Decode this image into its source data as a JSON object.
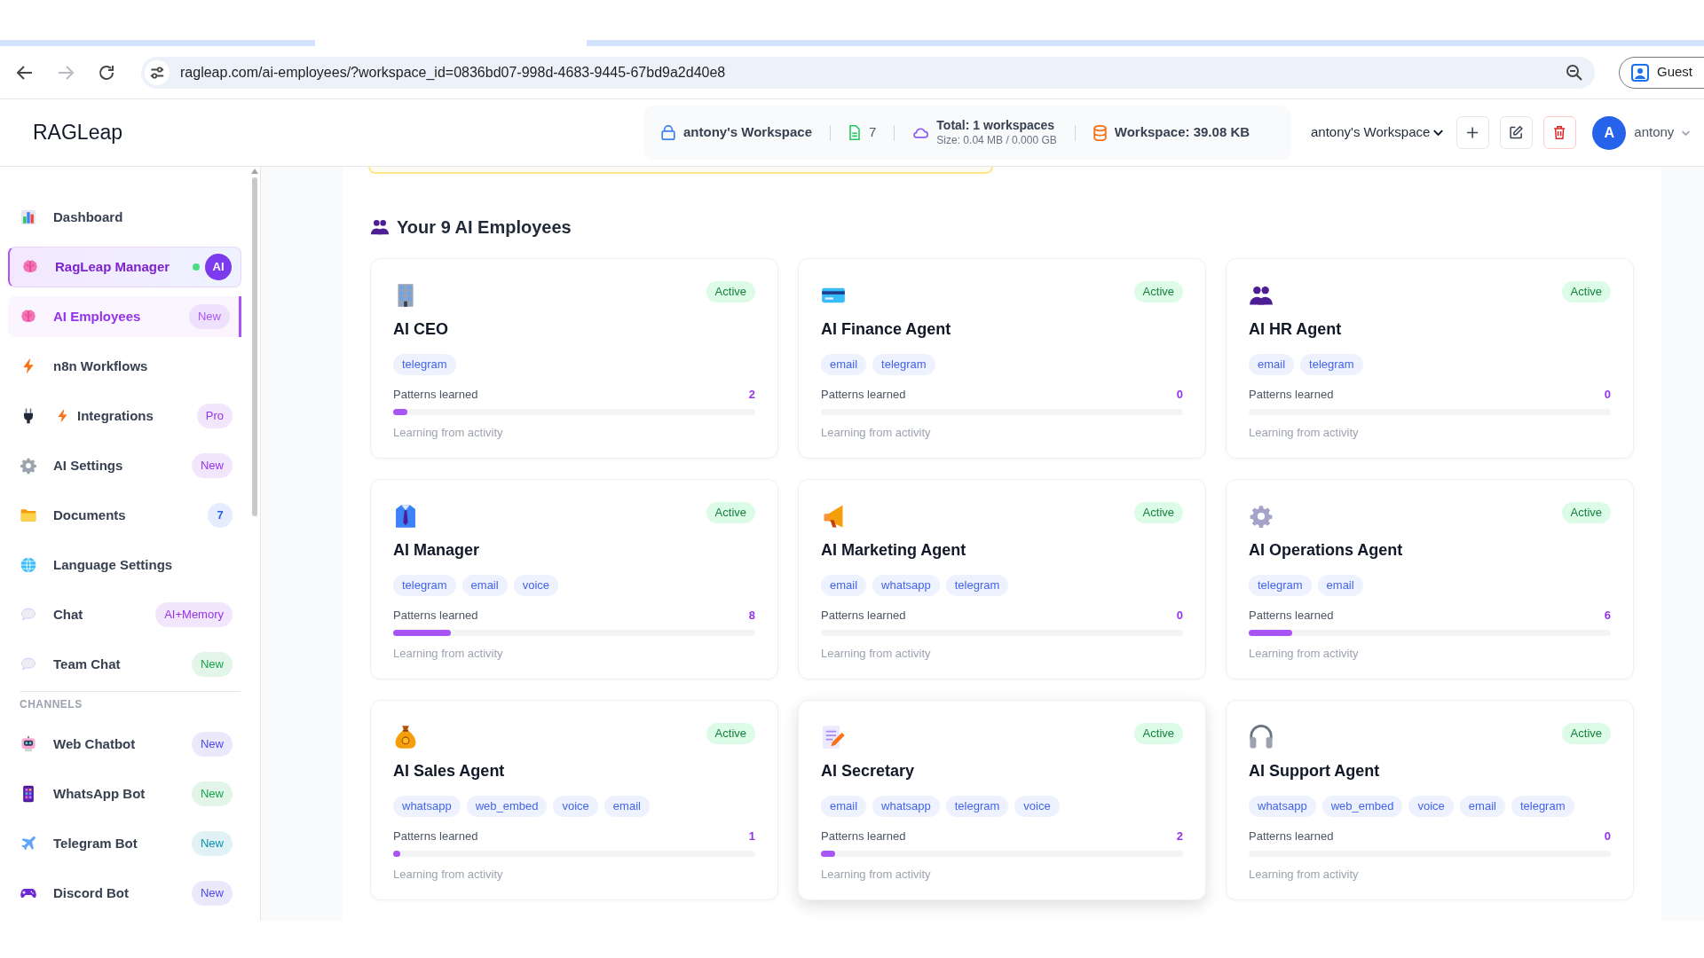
{
  "browser": {
    "nav": [
      {
        "kind": "back",
        "disabled": false
      },
      {
        "kind": "forward",
        "disabled": true
      },
      {
        "kind": "reload",
        "disabled": false
      }
    ],
    "url": "ragleap.com/ai-employees/?workspace_id=0836bd07-998d-4683-9445-67bd9a2d40e8",
    "profile_button": "Guest"
  },
  "header": {
    "logo": "RAGLeap",
    "workspace_info": {
      "name": "antony's Workspace",
      "documents": "7",
      "total": "Total: 1 workspaces",
      "size": "Size: 0.04 MB / 0.000 GB",
      "storage": "Workspace: 39.08 KB"
    },
    "workspace_select": "antony's Workspace",
    "user": {
      "initial": "A",
      "name": "antony"
    }
  },
  "sidebar": {
    "items": [
      {
        "label": "Dashboard",
        "kind": "link",
        "selected": false
      },
      {
        "label": "RagLeap Manager",
        "kind": "featured",
        "selected": false,
        "status_dot": {
          "color": "#4ade80"
        },
        "badge": {
          "text": "AI",
          "kind": "solid",
          "color": "#7c3aed"
        }
      },
      {
        "label": "AI Employees",
        "kind": "link",
        "selected": true,
        "badge": {
          "text": "New",
          "kind": "soft",
          "color": "#a855f7"
        }
      },
      {
        "label": "n8n Workflows",
        "kind": "link",
        "selected": false
      },
      {
        "label": "Integrations",
        "kind": "link",
        "selected": false,
        "badge": {
          "text": "Pro",
          "kind": "soft",
          "color": "#9333ea"
        }
      },
      {
        "label": "AI Settings",
        "kind": "link",
        "selected": false,
        "badge": {
          "text": "New",
          "kind": "soft",
          "color": "#9333ea"
        }
      },
      {
        "label": "Documents",
        "kind": "link",
        "selected": false,
        "badge": {
          "text": "7",
          "kind": "count",
          "color": "#2563eb"
        }
      },
      {
        "label": "Language Settings",
        "kind": "link",
        "selected": false
      },
      {
        "label": "Chat",
        "kind": "link",
        "selected": false,
        "badge": {
          "text": "AI+Memory",
          "kind": "soft",
          "color": "#9333ea"
        }
      },
      {
        "label": "Team Chat",
        "kind": "link",
        "selected": false,
        "badge": {
          "text": "New",
          "kind": "soft",
          "color": "#16a34a"
        }
      }
    ],
    "sections": [
      {
        "title": "CHANNELS",
        "items": [
          {
            "label": "Web Chatbot",
            "kind": "link",
            "selected": false,
            "badge": {
              "text": "New",
              "kind": "soft",
              "color": "#4f46e5"
            }
          },
          {
            "label": "WhatsApp Bot",
            "kind": "link",
            "selected": false,
            "badge": {
              "text": "New",
              "kind": "soft",
              "color": "#16a34a"
            }
          },
          {
            "label": "Telegram Bot",
            "kind": "link",
            "selected": false,
            "badge": {
              "text": "New",
              "kind": "soft",
              "color": "#0891b2"
            }
          },
          {
            "label": "Discord Bot",
            "kind": "link",
            "selected": false,
            "badge": {
              "text": "New",
              "kind": "soft",
              "color": "#4f46e5"
            }
          }
        ]
      }
    ]
  },
  "employees": {
    "title": "Your 9 AI Employees",
    "cards": [
      {
        "name": "AI CEO",
        "status": "Active",
        "channels": [
          "telegram"
        ],
        "patterns_label": "Patterns learned",
        "patterns": "2",
        "level": 0.04,
        "note": "Learning from activity",
        "hovered": false
      },
      {
        "name": "AI Finance Agent",
        "status": "Active",
        "channels": [
          "email",
          "telegram"
        ],
        "patterns_label": "Patterns learned",
        "patterns": "0",
        "level": 0,
        "note": "Learning from activity",
        "hovered": false
      },
      {
        "name": "AI HR Agent",
        "status": "Active",
        "channels": [
          "email",
          "telegram"
        ],
        "patterns_label": "Patterns learned",
        "patterns": "0",
        "level": 0,
        "note": "Learning from activity",
        "hovered": false
      },
      {
        "name": "AI Manager",
        "status": "Active",
        "channels": [
          "telegram",
          "email",
          "voice"
        ],
        "patterns_label": "Patterns learned",
        "patterns": "8",
        "level": 0.16,
        "note": "Learning from activity",
        "hovered": false
      },
      {
        "name": "AI Marketing Agent",
        "status": "Active",
        "channels": [
          "email",
          "whatsapp",
          "telegram"
        ],
        "patterns_label": "Patterns learned",
        "patterns": "0",
        "level": 0,
        "note": "Learning from activity",
        "hovered": false
      },
      {
        "name": "AI Operations Agent",
        "status": "Active",
        "channels": [
          "telegram",
          "email"
        ],
        "patterns_label": "Patterns learned",
        "patterns": "6",
        "level": 0.12,
        "note": "Learning from activity",
        "hovered": false
      },
      {
        "name": "AI Sales Agent",
        "status": "Active",
        "channels": [
          "whatsapp",
          "web_embed",
          "voice",
          "email"
        ],
        "patterns_label": "Patterns learned",
        "patterns": "1",
        "level": 0.02,
        "note": "Learning from activity",
        "hovered": false
      },
      {
        "name": "AI Secretary",
        "status": "Active",
        "channels": [
          "email",
          "whatsapp",
          "telegram",
          "voice"
        ],
        "patterns_label": "Patterns learned",
        "patterns": "2",
        "level": 0.04,
        "note": "Learning from activity",
        "hovered": true
      },
      {
        "name": "AI Support Agent",
        "status": "Active",
        "channels": [
          "whatsapp",
          "web_embed",
          "voice",
          "email",
          "telegram"
        ],
        "patterns_label": "Patterns learned",
        "patterns": "0",
        "level": 0,
        "note": "Learning from activity",
        "hovered": false
      }
    ]
  }
}
